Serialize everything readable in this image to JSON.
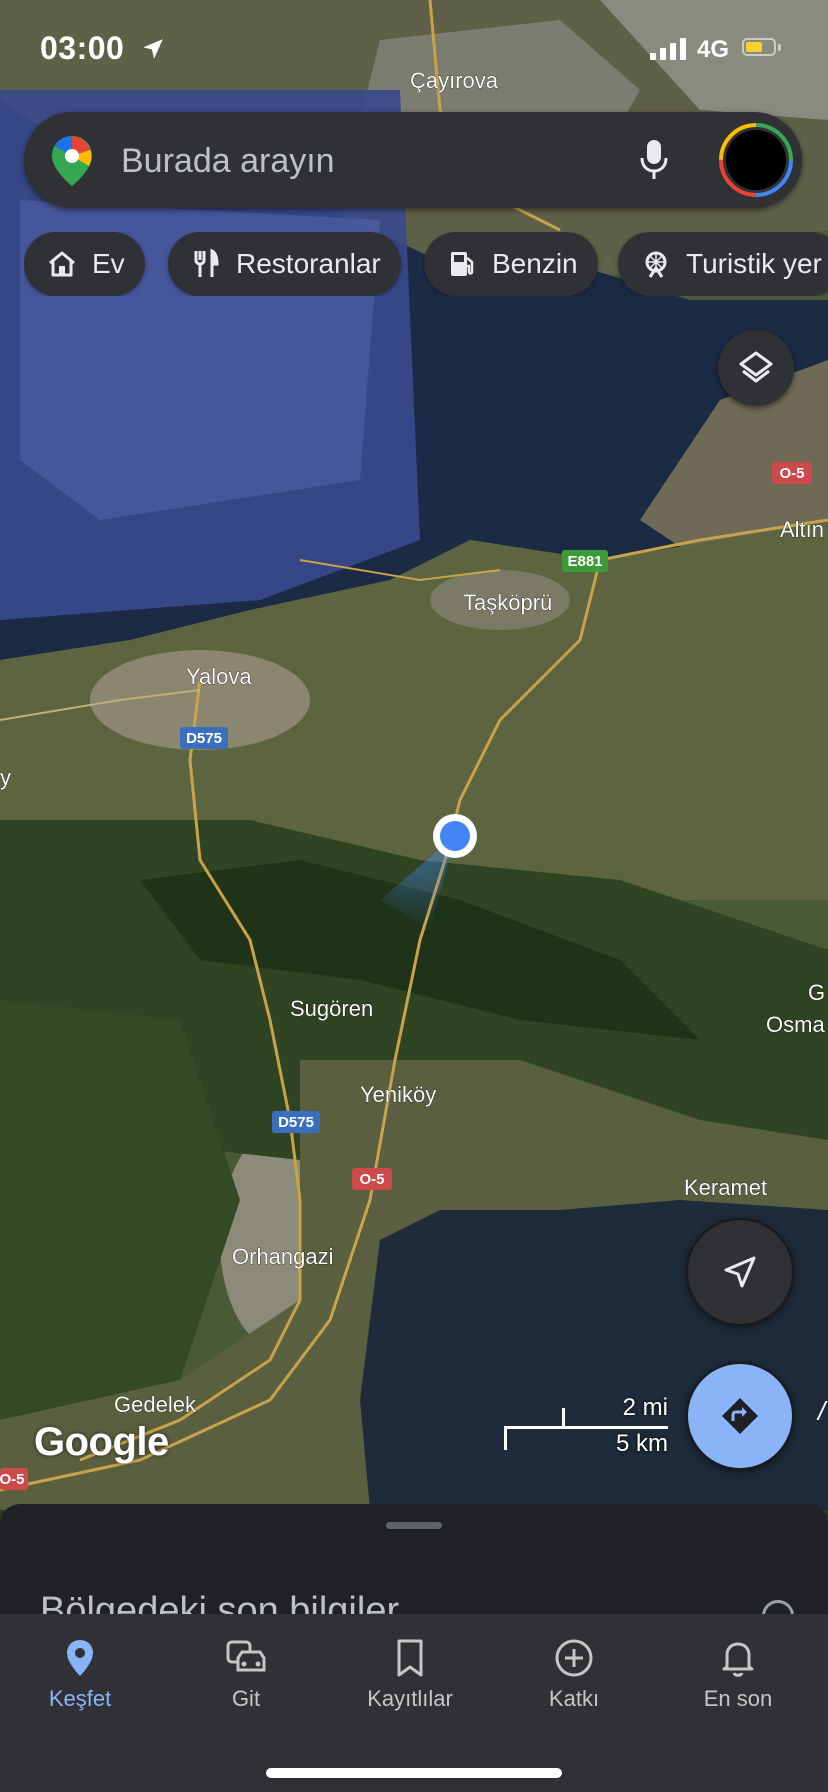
{
  "status_bar": {
    "time": "03:00",
    "network": "4G",
    "battery_level": 0.6,
    "colors": {
      "battery": "#f6d02f"
    }
  },
  "search": {
    "placeholder": "Burada arayın"
  },
  "chips": [
    {
      "label": "Ev",
      "icon": "home-icon"
    },
    {
      "label": "Restoranlar",
      "icon": "restaurant-icon"
    },
    {
      "label": "Benzin",
      "icon": "gas-station-icon"
    },
    {
      "label": "Turistik yer",
      "icon": "attraction-icon"
    }
  ],
  "map": {
    "place_labels": [
      "Çayırova",
      "Taşköprü",
      "Yalova",
      "Altın",
      "Sugören",
      "Yeniköy",
      "Orhangazi",
      "Keramet",
      "Gedelek",
      "Osma",
      "G",
      "y"
    ],
    "road_shields": [
      "E881",
      "D575",
      "D575",
      "O-5",
      "O-5",
      "O-5"
    ],
    "scale": {
      "miles": "2 mi",
      "km": "5 km"
    },
    "attribution": "Google",
    "edge_char": "/",
    "colors": {
      "accent": "#8ab4f8",
      "location_dot": "#4285f4",
      "water": "#1b2a45"
    }
  },
  "sheet": {
    "title": "Bölgedeki son bilgiler"
  },
  "nav": {
    "items": [
      {
        "label": "Keşfet",
        "icon": "explore-pin-icon",
        "active": true
      },
      {
        "label": "Git",
        "icon": "commute-car-icon",
        "active": false
      },
      {
        "label": "Kayıtlılar",
        "icon": "bookmark-icon",
        "active": false
      },
      {
        "label": "Katkı",
        "icon": "add-circle-icon",
        "active": false
      },
      {
        "label": "En son",
        "icon": "bell-icon",
        "active": false
      }
    ]
  }
}
